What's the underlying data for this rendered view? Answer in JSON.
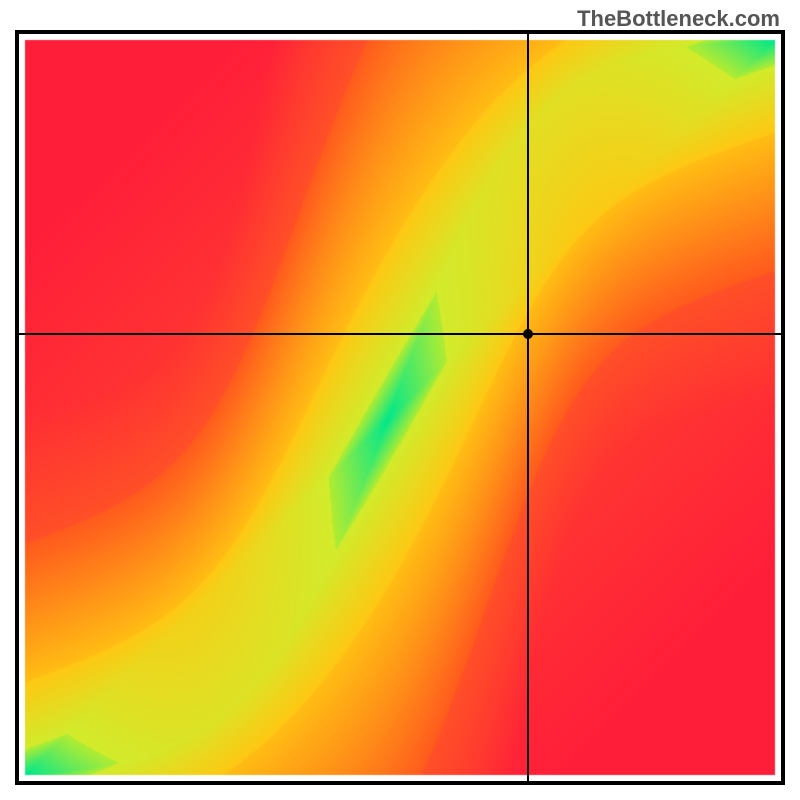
{
  "watermark": "TheBottleneck.com",
  "chart_data": {
    "type": "heatmap",
    "title": "",
    "xlabel": "",
    "ylabel": "",
    "xlim": [
      0,
      100
    ],
    "ylim": [
      0,
      100
    ],
    "crosshair": {
      "x": 67,
      "y": 60
    },
    "marker": {
      "x": 67,
      "y": 60
    },
    "color_stops": {
      "optimal": "#00E88C",
      "near": "#E8EC2C",
      "warning": "#FF9E1A",
      "bad": "#FF2B3A"
    },
    "optimal_curve_description": "Optimal (green) band follows an S-shaped diagonal from (0,0) to (100,100); band width ~6% of axis range. Colors fade from green → yellow → orange → red with distance from the band.",
    "optimal_curve_samples": [
      {
        "x": 0,
        "y": 0
      },
      {
        "x": 10,
        "y": 6
      },
      {
        "x": 20,
        "y": 14
      },
      {
        "x": 30,
        "y": 24
      },
      {
        "x": 40,
        "y": 36
      },
      {
        "x": 50,
        "y": 50
      },
      {
        "x": 55,
        "y": 59
      },
      {
        "x": 60,
        "y": 68
      },
      {
        "x": 65,
        "y": 75
      },
      {
        "x": 70,
        "y": 80
      },
      {
        "x": 80,
        "y": 88
      },
      {
        "x": 90,
        "y": 94
      },
      {
        "x": 100,
        "y": 100
      }
    ]
  }
}
